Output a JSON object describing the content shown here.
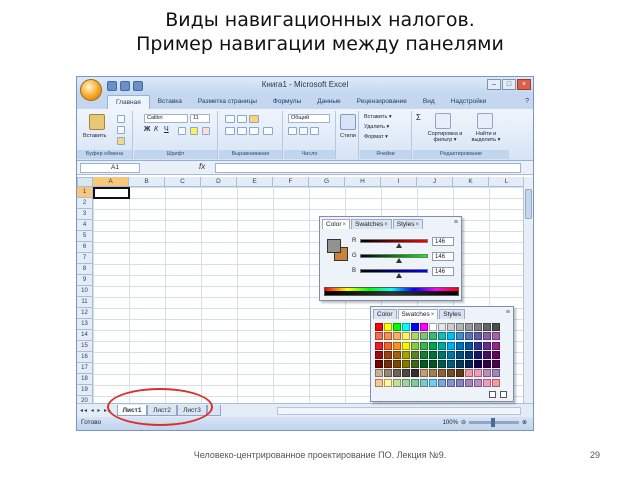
{
  "slide": {
    "title_line1": "Виды навигационных налогов.",
    "title_line2": "Пример навигации между панелями",
    "footer": "Человеко-центрированное проектирование ПО. Лекция №9.",
    "page_number": "29"
  },
  "excel": {
    "window_title": "Книга1 - Microsoft Excel",
    "controls": {
      "minimize": "–",
      "maximize": "□",
      "close": "×"
    },
    "ribbon_tabs": [
      "Главная",
      "Вставка",
      "Разметка страницы",
      "Формулы",
      "Данные",
      "Рецензирование",
      "Вид",
      "Надстройки"
    ],
    "ribbon": {
      "paste_label": "Вставить",
      "font_name": "Calibri",
      "font_size": "11",
      "number_format": "Общий",
      "styles_label": "Стили",
      "insert_label": "Вставить ▾",
      "delete_label": "Удалить ▾",
      "format_label": "Формат ▾",
      "sort_label": "Сортировка и фильтр ▾",
      "find_label": "Найти и выделить ▾",
      "groups": [
        "Буфер обмена",
        "Шрифт",
        "Выравнивание",
        "Число",
        "Ячейки",
        "Редактирование"
      ]
    },
    "formula_bar": {
      "name_box": "A1",
      "fx": "fx",
      "content": ""
    },
    "columns": [
      "A",
      "B",
      "C",
      "D",
      "E",
      "F",
      "G",
      "H",
      "I",
      "J",
      "K",
      "L"
    ],
    "rows": [
      "1",
      "2",
      "3",
      "4",
      "5",
      "6",
      "7",
      "8",
      "9",
      "10",
      "11",
      "12",
      "13",
      "14",
      "15",
      "16",
      "17",
      "18",
      "19",
      "20"
    ],
    "sheet_tabs": [
      "Лист1",
      "Лист2",
      "Лист3"
    ],
    "status": "Готово",
    "zoom": "100%"
  },
  "color_panel": {
    "tabs": [
      "Color",
      "Swatches",
      "Styles"
    ],
    "channels": [
      {
        "label": "R",
        "value": "146",
        "level": 0.57
      },
      {
        "label": "G",
        "value": "146",
        "level": 0.57
      },
      {
        "label": "B",
        "value": "146",
        "level": 0.57
      }
    ],
    "foreground": "#929292",
    "background": "#c9823a"
  },
  "swatches_panel": {
    "tabs": [
      "Color",
      "Swatches",
      "Styles"
    ],
    "colors": [
      "#ff0000",
      "#ffff00",
      "#00ff00",
      "#00ffff",
      "#0000ff",
      "#ff00ff",
      "#ffffff",
      "#e6e6e6",
      "#cccccc",
      "#b3b3b3",
      "#999999",
      "#808080",
      "#666666",
      "#4d4d4d",
      "#f26c4f",
      "#f68e55",
      "#fbaf5c",
      "#fff467",
      "#acd372",
      "#7cc576",
      "#3bb878",
      "#1abbb4",
      "#00bff3",
      "#438ccb",
      "#5574b9",
      "#605ca8",
      "#855fa8",
      "#a763a8",
      "#ed1c24",
      "#f26522",
      "#f7941d",
      "#fff200",
      "#8dc73f",
      "#39b54a",
      "#00a651",
      "#00a99d",
      "#00aeef",
      "#0072bc",
      "#0054a6",
      "#2e3192",
      "#662d91",
      "#92278f",
      "#9e0b0f",
      "#a0410d",
      "#a36209",
      "#aba000",
      "#598527",
      "#1a7b30",
      "#007236",
      "#00746b",
      "#0076a3",
      "#004b80",
      "#003471",
      "#1b1464",
      "#440e62",
      "#630460",
      "#790000",
      "#7b2e00",
      "#7d4900",
      "#827b00",
      "#406618",
      "#005e20",
      "#005826",
      "#005952",
      "#005b7f",
      "#003663",
      "#002157",
      "#0d004c",
      "#32004b",
      "#4b0049",
      "#c7b299",
      "#998675",
      "#736357",
      "#534741",
      "#37302d",
      "#c69c6d",
      "#a67c52",
      "#8c6239",
      "#754c24",
      "#603913",
      "#f5989d",
      "#f49ac1",
      "#bd8cbf",
      "#a186be",
      "#fdc68a",
      "#fff799",
      "#c4df9b",
      "#a2d39c",
      "#82ca9d",
      "#7accc8",
      "#6dcff6",
      "#7da7d9",
      "#8393ca",
      "#8882be",
      "#a187be",
      "#bc8dbf",
      "#f49ac2",
      "#f6989d"
    ]
  }
}
